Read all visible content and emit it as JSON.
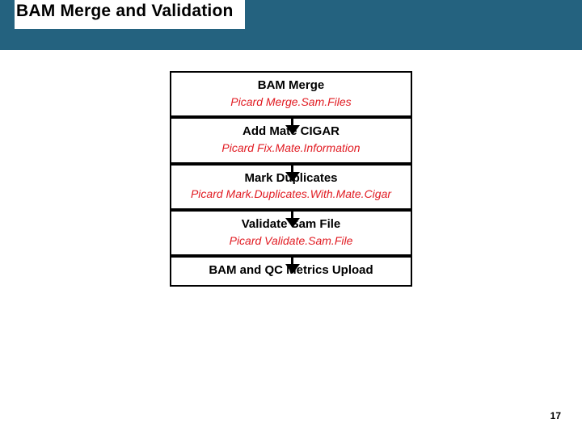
{
  "title": "BAM Merge and Validation",
  "steps": [
    {
      "label": "BAM Merge",
      "tool": "Picard Merge.Sam.Files"
    },
    {
      "label": "Add Mate CIGAR",
      "tool": "Picard Fix.Mate.Information"
    },
    {
      "label": "Mark Duplicates",
      "tool": "Picard Mark.Duplicates.With.Mate.Cigar"
    },
    {
      "label": "Validate Sam File",
      "tool": "Picard Validate.Sam.File"
    },
    {
      "label": "BAM and QC Metrics Upload",
      "tool": ""
    }
  ],
  "page_number": "17"
}
